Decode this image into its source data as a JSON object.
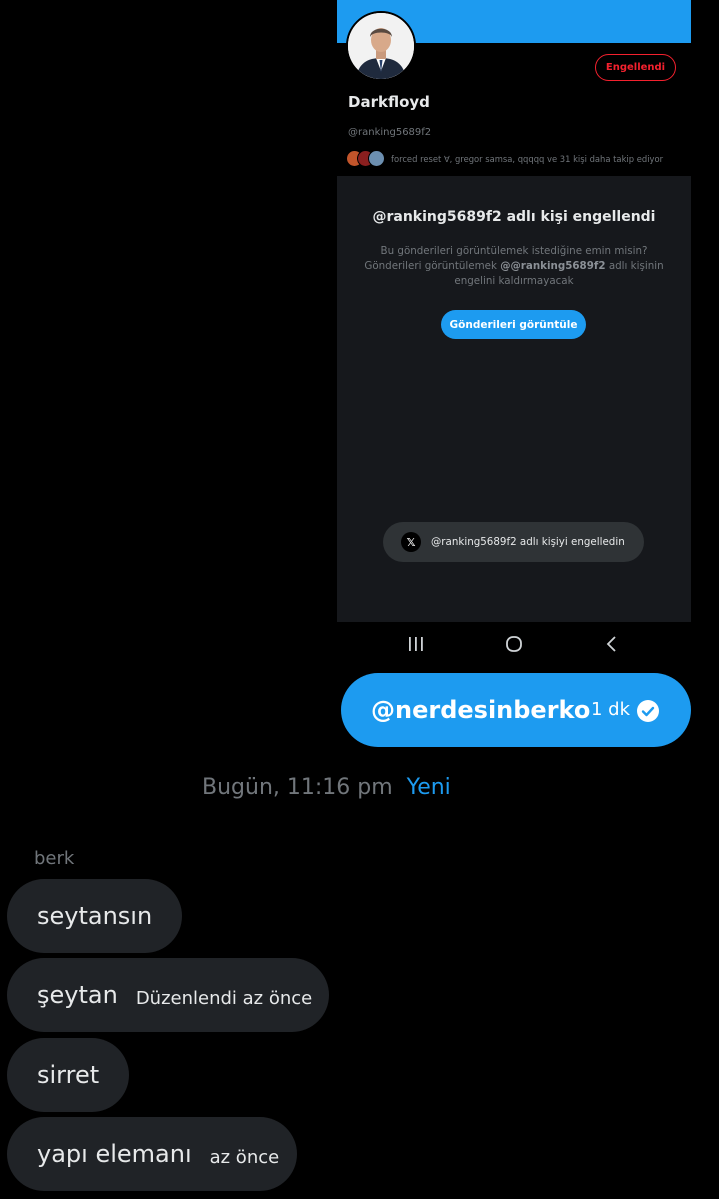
{
  "screenshot": {
    "profile": {
      "name": "Darkfloyd",
      "handle": "@ranking5689f2",
      "blocked_button": "Engellendi",
      "followers_text": "forced reset ∀, gregor samsa, qqqqq ve 31 kişi daha takip ediyor"
    },
    "blocked_panel": {
      "title": "@ranking5689f2 adlı kişi engellendi",
      "line1": "Bu gönderileri görüntülemek istediğine emin misin?",
      "line2_prefix": "Gönderileri görüntülemek ",
      "line2_handle": "@@ranking5689f2",
      "line2_suffix": " adlı kişinin",
      "line3": "engelini kaldırmayacak",
      "button": "Gönderileri görüntüle"
    },
    "toast": {
      "icon": "x-logo-icon",
      "text": "@ranking5689f2 adlı kişiyi engelledin"
    },
    "navbar": {
      "icons": [
        "recent-apps-icon",
        "home-icon",
        "back-icon"
      ]
    }
  },
  "sent_message": {
    "text": "@nerdesinberko",
    "time": "1 dk",
    "status_icon": "read-check-icon"
  },
  "separator": {
    "date": "Bugün, 11:16 pm",
    "new_label": "Yeni"
  },
  "conversation": {
    "sender": "berk",
    "messages": [
      {
        "text": "seytansın",
        "meta": ""
      },
      {
        "text": "şeytan",
        "meta": "Düzenlendi az önce"
      },
      {
        "text": "sirret",
        "meta": ""
      },
      {
        "text": "yapı elemanı",
        "meta": "az önce"
      }
    ]
  },
  "colors": {
    "accent": "#1d9bf0",
    "danger": "#f4212e",
    "bubble_received": "#202327"
  }
}
